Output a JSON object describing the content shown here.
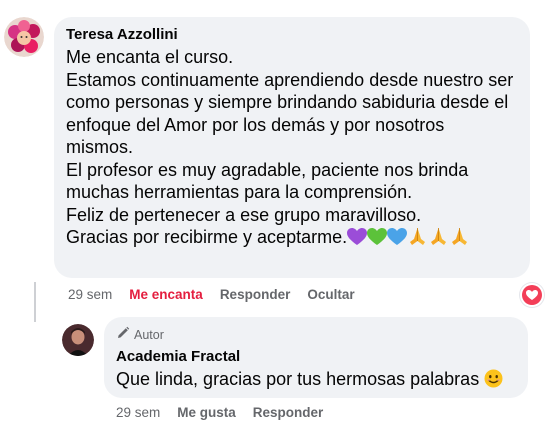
{
  "comment": {
    "author": "Teresa Azzollini",
    "lines": [
      "Me encanta el curso.",
      "Estamos continuamente aprendiendo desde nuestro ser",
      "como personas y siempre brindando sabiduria desde el",
      "enfoque del Amor por los demás y por nosotros",
      "mismos.",
      "El profesor es muy agradable, paciente nos brinda",
      "muchas herramientas para la comprensión.",
      "Feliz de pertenecer a ese grupo maravilloso.",
      "Gracias por recibirme y aceptarme."
    ],
    "trailing_emojis": [
      "purple-heart",
      "green-heart",
      "blue-heart",
      "folded-hands",
      "folded-hands",
      "folded-hands"
    ],
    "time": "29 sem",
    "like_label": "Me encanta",
    "reply_label": "Responder",
    "hide_label": "Ocultar",
    "reaction_icon": "love-reaction-icon",
    "colors": {
      "liked": "#e41e3f",
      "bubble": "#f0f2f5",
      "meta": "#65676b"
    }
  },
  "reply": {
    "badge": "Autor",
    "badge_icon": "pencil-icon",
    "author": "Academia Fractal",
    "text": "Que linda, gracias por tus hermosas palabras",
    "trailing_emoji": "smiling-face",
    "time": "29 sem",
    "like_label": "Me gusta",
    "reply_label": "Responder"
  }
}
